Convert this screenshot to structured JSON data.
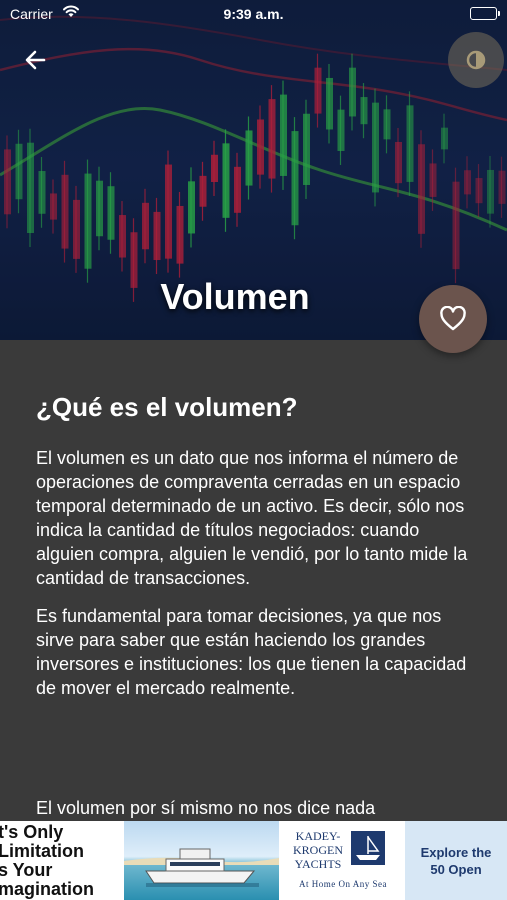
{
  "status_bar": {
    "carrier": "Carrier",
    "time": "9:39 a.m."
  },
  "hero": {
    "title": "Volumen"
  },
  "article": {
    "heading": "¿Qué es el volumen?",
    "paragraphs": [
      "El volumen es un dato que nos informa el número de operaciones de compraventa cerradas en un espacio temporal determinado de un activo. Es decir, sólo nos indica la cantidad de títulos negociados: cuando alguien compra, alguien le vendió, por lo tanto mide la cantidad de transacciones.",
      "Es fundamental para tomar decisiones, ya que nos sirve para saber que están haciendo los grandes inversores e instituciones: los que tienen la capacidad de mover el mercado realmente."
    ],
    "next_paragraph": "El volumen por sí mismo no nos dice nada"
  },
  "ad": {
    "slogan_lines": [
      "t's Only",
      "Limitation",
      "s Your",
      "magination"
    ],
    "brand_lines": [
      "KADEY-",
      "KROGEN",
      "YACHTS"
    ],
    "tagline": "At Home On Any Sea",
    "cta": "Explore the 50 Open"
  },
  "icons": {
    "back": "arrow-left-icon",
    "theme": "brightness-icon",
    "favorite": "heart-outline-icon",
    "wifi": "wifi-icon",
    "battery": "battery-icon"
  },
  "colors": {
    "content_bg": "#3a3a3a",
    "hero_bg": "#132249",
    "fav_button": "#6b544d",
    "candle_up": "#2fbf4a",
    "candle_down": "#d0203a"
  }
}
